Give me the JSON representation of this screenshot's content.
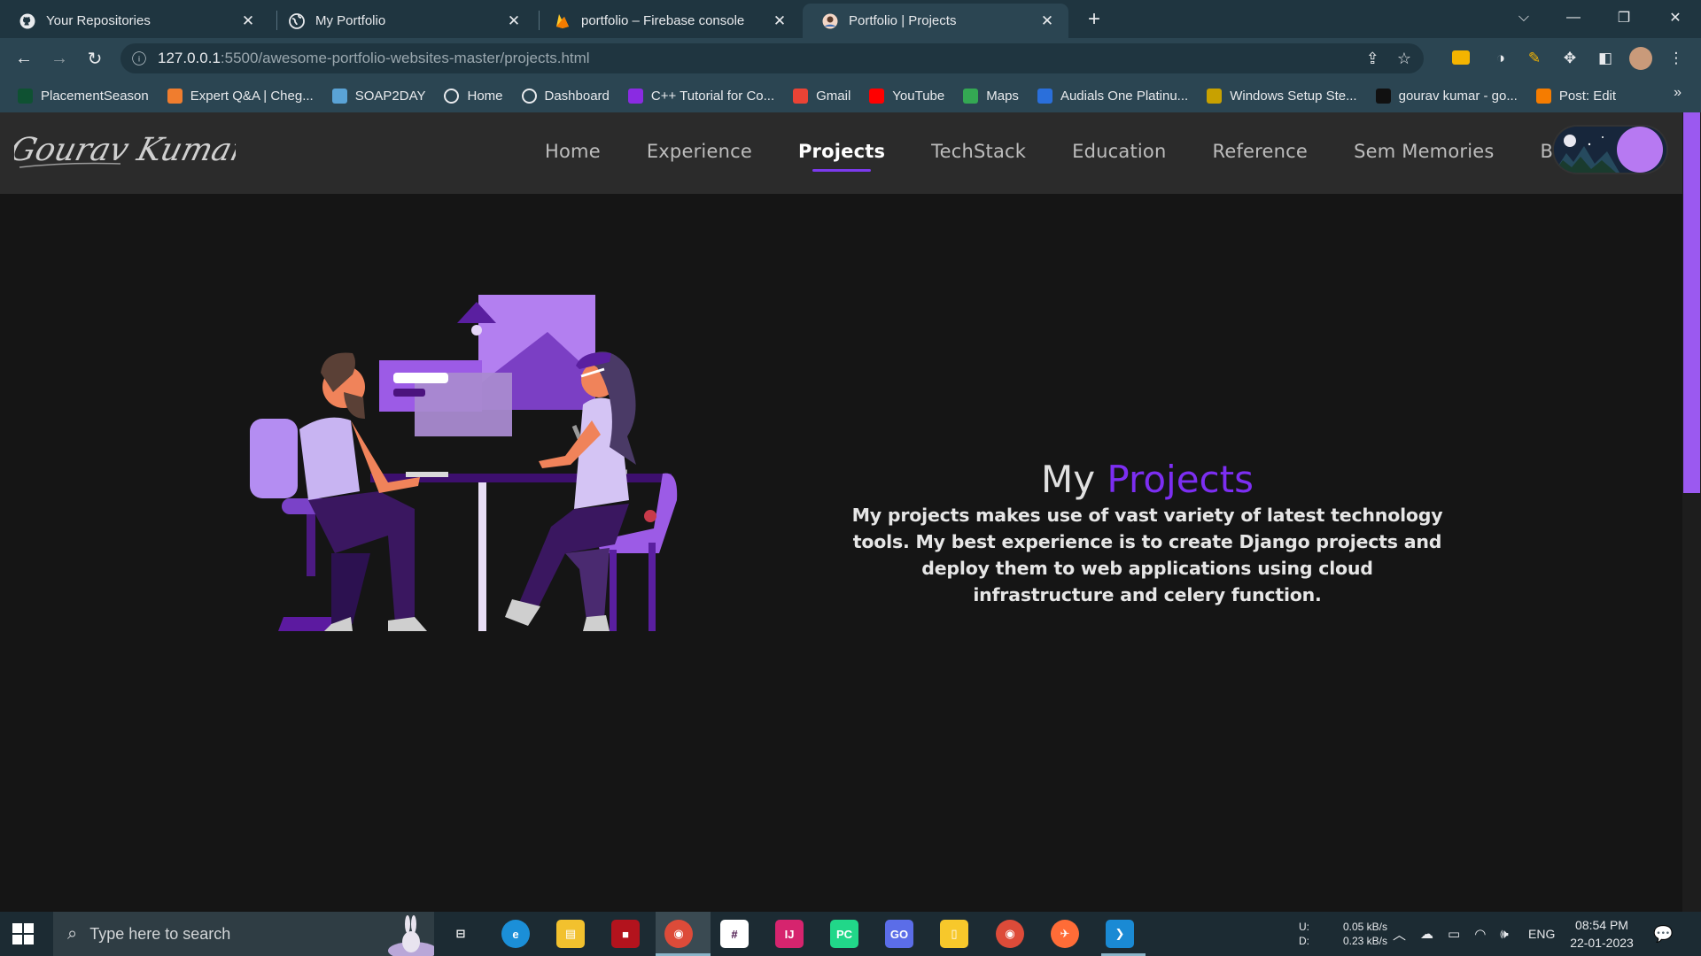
{
  "browser": {
    "tabs": [
      {
        "title": "Your Repositories",
        "icon": "github-icon",
        "active": false
      },
      {
        "title": "My Portfolio",
        "icon": "globe-icon",
        "active": false
      },
      {
        "title": "portfolio – Firebase console",
        "icon": "firebase-icon",
        "active": false
      },
      {
        "title": "Portfolio | Projects",
        "icon": "avatar-icon",
        "active": true
      }
    ],
    "url_host": "127.0.0.1",
    "url_path": ":5500/awesome-portfolio-websites-master/projects.html",
    "bookmarks": [
      {
        "label": "PlacementSeason",
        "icon": "placementseason-icon",
        "color": "#0f5132"
      },
      {
        "label": "Expert Q&A | Cheg...",
        "icon": "chegg-icon",
        "color": "#f07d2e"
      },
      {
        "label": "SOAP2DAY",
        "icon": "soap2day-icon",
        "color": "#5aa3d6"
      },
      {
        "label": "Home",
        "icon": "globe-icon",
        "color": "#5f6368"
      },
      {
        "label": "Dashboard",
        "icon": "globe-icon",
        "color": "#5f6368"
      },
      {
        "label": "C++ Tutorial for Co...",
        "icon": "cpp-icon",
        "color": "#8a2be2"
      },
      {
        "label": "Gmail",
        "icon": "gmail-icon",
        "color": "#ea4335"
      },
      {
        "label": "YouTube",
        "icon": "youtube-icon",
        "color": "#ff0000"
      },
      {
        "label": "Maps",
        "icon": "maps-icon",
        "color": "#34a853"
      },
      {
        "label": "Audials One Platinu...",
        "icon": "audials-icon",
        "color": "#2a6fdb"
      },
      {
        "label": "Windows Setup Ste...",
        "icon": "windows-setup-icon",
        "color": "#c8a100"
      },
      {
        "label": "gourav kumar - go...",
        "icon": "medium-icon",
        "color": "#111111"
      },
      {
        "label": "Post: Edit",
        "icon": "blogger-icon",
        "color": "#f57c00"
      }
    ]
  },
  "site": {
    "logo_text": "Gourav Kumar",
    "nav": [
      "Home",
      "Experience",
      "Projects",
      "TechStack",
      "Education",
      "Reference",
      "Sem Memories",
      "Blogs"
    ],
    "active_nav": "Projects",
    "hero_title_plain": "My",
    "hero_title_accent": "Projects",
    "hero_text": "My projects makes use of vast variety of latest technology tools. My best experience is to create Django projects and deploy them to web applications using cloud infrastructure and celery function.",
    "accent_color": "#7c2ef2"
  },
  "taskbar": {
    "search_placeholder": "Type here to search",
    "net_up_label": "U:",
    "net_down_label": "D:",
    "net_up": "0.05 kB/s",
    "net_down": "0.23 kB/s",
    "language": "ENG",
    "time": "08:54 PM",
    "date": "22-01-2023",
    "apps": [
      "task-view-icon",
      "edge-icon",
      "file-explorer-icon",
      "red-app-icon",
      "chrome-icon",
      "slack-icon",
      "intellij-icon",
      "pycharm-icon",
      "goland-icon",
      "sticky-notes-icon",
      "chrome-icon",
      "postman-icon",
      "vscode-icon"
    ]
  }
}
